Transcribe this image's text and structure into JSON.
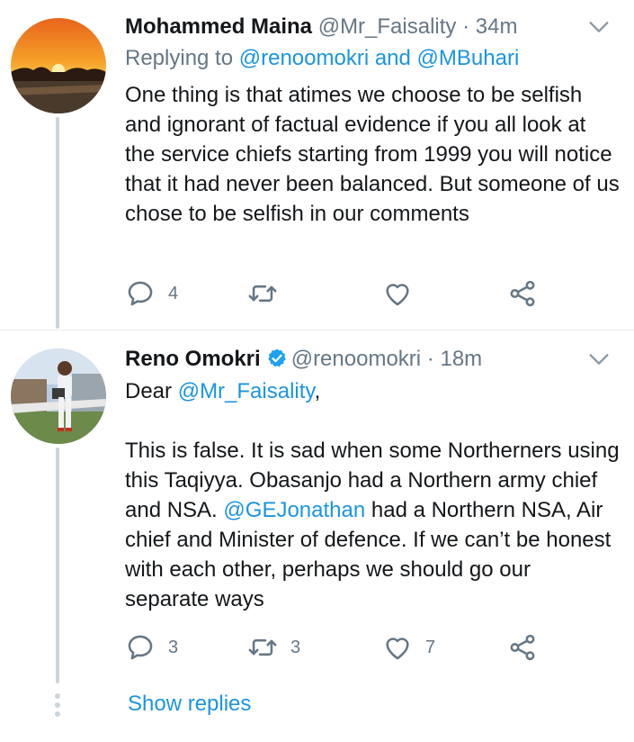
{
  "tweets": [
    {
      "name": "Mohammed Maina",
      "handle": "@Mr_Faisality",
      "dot": "·",
      "time": "34m",
      "reply_prefix": "Replying to",
      "reply_users": "@renoomokri and @MBuhari",
      "body": "One thing is that atimes we choose to be selfish and ignorant of factual evidence if you all look at the service chiefs starting from 1999 you will notice that it had never been balanced. But someone of us chose to be selfish in our comments",
      "reply_count": "4",
      "retweet_count": "",
      "like_count": ""
    },
    {
      "name": "Reno Omokri",
      "handle": "@renoomokri",
      "dot": "·",
      "time": "18m",
      "greeting": "Dear",
      "mention": "@Mr_Faisality",
      "greeting_end": ",",
      "body_part1": "This is false. It is sad when some Northerners using this Taqiyya. Obasanjo had a Northern army chief and NSA.",
      "mention2": "@GEJonathan",
      "body_part2": "had a Northern NSA, Air chief and Minister of defence. If we can’t be honest with each other, perhaps we should go our separate ways",
      "reply_count": "3",
      "retweet_count": "3",
      "like_count": "7"
    }
  ],
  "show_replies": "Show replies",
  "colors": {
    "link": "#1b95e0",
    "muted": "#657786",
    "verified": "#1da1f2",
    "thread": "#cbd5dc"
  }
}
